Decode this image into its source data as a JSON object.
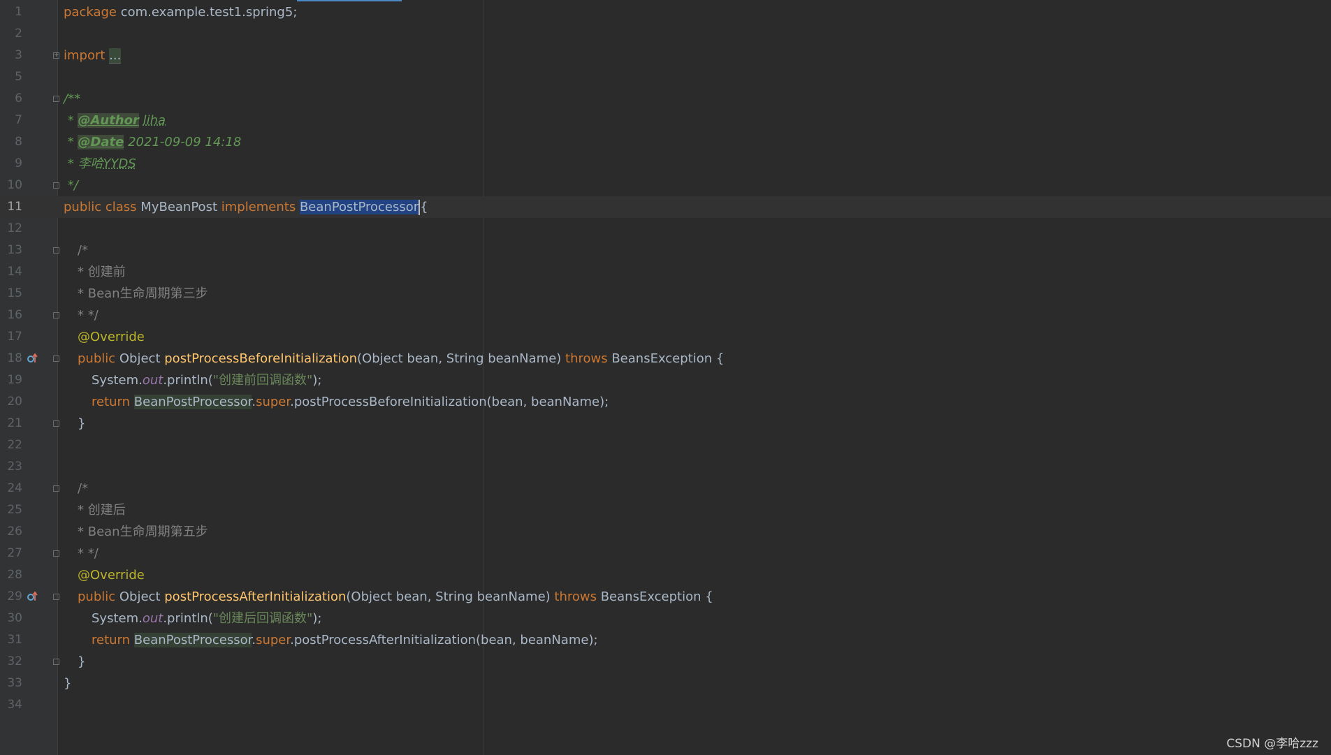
{
  "editor": {
    "lines": [
      {
        "n": "1",
        "segs": [
          [
            "kw",
            "package "
          ],
          [
            "cls",
            "com.example.test1.spring5;"
          ]
        ]
      },
      {
        "n": "2",
        "segs": []
      },
      {
        "n": "3",
        "fold": "+",
        "segs": [
          [
            "kw",
            "import "
          ],
          [
            "folded",
            "..."
          ]
        ]
      },
      {
        "n": "5",
        "segs": []
      },
      {
        "n": "6",
        "fold": "-",
        "segs": [
          [
            "doc",
            "/**"
          ]
        ]
      },
      {
        "n": "7",
        "segs": [
          [
            "doc",
            " * "
          ],
          [
            "doctag",
            "@Author"
          ],
          [
            "doc",
            " "
          ],
          [
            "docval",
            "liha"
          ]
        ]
      },
      {
        "n": "8",
        "segs": [
          [
            "doc",
            " * "
          ],
          [
            "doctag",
            "@Date"
          ],
          [
            "doc",
            " 2021-09-09 14:18"
          ]
        ]
      },
      {
        "n": "9",
        "segs": [
          [
            "doc",
            " * 李哈"
          ],
          [
            "docval",
            "YYDS"
          ]
        ]
      },
      {
        "n": "10",
        "fold": "-",
        "segs": [
          [
            "doc",
            " */"
          ]
        ]
      },
      {
        "n": "11",
        "current": true,
        "segs": [
          [
            "kw",
            "public class "
          ],
          [
            "cls",
            "MyBeanPost "
          ],
          [
            "kw",
            "implements "
          ],
          [
            "sel",
            "BeanPostProcessor"
          ],
          [
            "caret",
            ""
          ],
          [
            "cls",
            "{"
          ]
        ]
      },
      {
        "n": "12",
        "segs": []
      },
      {
        "n": "13",
        "fold": "-",
        "indent": 1,
        "segs": [
          [
            "comment",
            "/*"
          ]
        ]
      },
      {
        "n": "14",
        "indent": 1,
        "segs": [
          [
            "comment",
            "* 创建前"
          ]
        ]
      },
      {
        "n": "15",
        "indent": 1,
        "segs": [
          [
            "comment",
            "* Bean生命周期第三步"
          ]
        ]
      },
      {
        "n": "16",
        "fold": "-",
        "indent": 1,
        "segs": [
          [
            "comment",
            "* */"
          ]
        ]
      },
      {
        "n": "17",
        "indent": 1,
        "segs": [
          [
            "ann",
            "@Override"
          ]
        ]
      },
      {
        "n": "18",
        "icon": "override",
        "fold": "-",
        "indent": 1,
        "segs": [
          [
            "kw",
            "public "
          ],
          [
            "cls",
            "Object "
          ],
          [
            "method",
            "postProcessBeforeInitialization"
          ],
          [
            "cls",
            "(Object bean, String beanName) "
          ],
          [
            "kw",
            "throws "
          ],
          [
            "cls",
            "BeansException {"
          ]
        ]
      },
      {
        "n": "19",
        "indent": 2,
        "segs": [
          [
            "cls",
            "System."
          ],
          [
            "field",
            "out"
          ],
          [
            "cls",
            ".println("
          ],
          [
            "str",
            "\"创建前回调函数\""
          ],
          [
            "cls",
            ");"
          ]
        ]
      },
      {
        "n": "20",
        "indent": 2,
        "segs": [
          [
            "kw",
            "return "
          ],
          [
            "ifaceref",
            "BeanPostProcessor"
          ],
          [
            "cls",
            "."
          ],
          [
            "super",
            "super"
          ],
          [
            "cls",
            ".postProcessBeforeInitialization(bean, beanName);"
          ]
        ]
      },
      {
        "n": "21",
        "fold": "-",
        "indent": 1,
        "segs": [
          [
            "cls",
            "}"
          ]
        ]
      },
      {
        "n": "22",
        "segs": []
      },
      {
        "n": "23",
        "segs": []
      },
      {
        "n": "24",
        "fold": "-",
        "indent": 1,
        "segs": [
          [
            "comment",
            "/*"
          ]
        ]
      },
      {
        "n": "25",
        "indent": 1,
        "segs": [
          [
            "comment",
            "* 创建后"
          ]
        ]
      },
      {
        "n": "26",
        "indent": 1,
        "segs": [
          [
            "comment",
            "* Bean生命周期第五步"
          ]
        ]
      },
      {
        "n": "27",
        "fold": "-",
        "indent": 1,
        "segs": [
          [
            "comment",
            "* */"
          ]
        ]
      },
      {
        "n": "28",
        "indent": 1,
        "segs": [
          [
            "ann",
            "@Override"
          ]
        ]
      },
      {
        "n": "29",
        "icon": "override",
        "fold": "-",
        "indent": 1,
        "segs": [
          [
            "kw",
            "public "
          ],
          [
            "cls",
            "Object "
          ],
          [
            "method",
            "postProcessAfterInitialization"
          ],
          [
            "cls",
            "(Object bean, String beanName) "
          ],
          [
            "kw",
            "throws "
          ],
          [
            "cls",
            "BeansException {"
          ]
        ]
      },
      {
        "n": "30",
        "indent": 2,
        "segs": [
          [
            "cls",
            "System."
          ],
          [
            "field",
            "out"
          ],
          [
            "cls",
            ".println("
          ],
          [
            "str",
            "\"创建后回调函数\""
          ],
          [
            "cls",
            ");"
          ]
        ]
      },
      {
        "n": "31",
        "indent": 2,
        "segs": [
          [
            "kw",
            "return "
          ],
          [
            "ifaceref",
            "BeanPostProcessor"
          ],
          [
            "cls",
            "."
          ],
          [
            "super",
            "super"
          ],
          [
            "cls",
            ".postProcessAfterInitialization(bean, beanName);"
          ]
        ]
      },
      {
        "n": "32",
        "fold": "-",
        "indent": 1,
        "segs": [
          [
            "cls",
            "}"
          ]
        ]
      },
      {
        "n": "33",
        "segs": [
          [
            "cls",
            "}"
          ]
        ]
      },
      {
        "n": "34",
        "segs": []
      }
    ]
  },
  "watermark": "CSDN @李哈zzz",
  "colors": {
    "background": "#2b2b2b",
    "keyword": "#cc7832",
    "method": "#ffc66d",
    "string": "#6a8759",
    "annotation": "#bbb529",
    "selection": "#214283"
  }
}
